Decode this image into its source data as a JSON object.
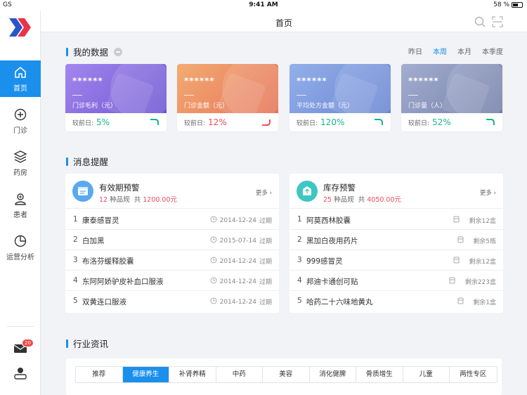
{
  "status_bar": {
    "carrier": "GS",
    "time": "9:41 AM",
    "battery": "58 %"
  },
  "sidebar": {
    "items": [
      {
        "label": "首页",
        "icon": "home-icon",
        "active": true
      },
      {
        "label": "门诊",
        "icon": "clinic-icon",
        "active": false
      },
      {
        "label": "药房",
        "icon": "layers-icon",
        "active": false
      },
      {
        "label": "患者",
        "icon": "patient-icon",
        "active": false
      },
      {
        "label": "运营分析",
        "icon": "pie-chart-icon",
        "active": false
      }
    ],
    "message_badge": "20"
  },
  "header": {
    "title": "首页"
  },
  "my_data": {
    "title": "我的数据",
    "periods": [
      "昨日",
      "本周",
      "本月",
      "本季度"
    ],
    "active_period": "本周",
    "cards": [
      {
        "masked": "******",
        "label": "门诊毛利（元）",
        "compare_label": "较前日:",
        "pct": "5%",
        "trend": "up",
        "gradient": [
          "#9b7de8",
          "#6f5bd4"
        ]
      },
      {
        "masked": "******",
        "label": "门诊金额（元）",
        "compare_label": "较前日:",
        "pct": "12%",
        "trend": "down",
        "gradient": [
          "#f2a36c",
          "#e8785c"
        ]
      },
      {
        "masked": "******",
        "label": "平均处方金额（元）",
        "compare_label": "较前日:",
        "pct": "120%",
        "trend": "up",
        "gradient": [
          "#8aa8e6",
          "#6c88d4"
        ]
      },
      {
        "masked": "******",
        "label": "门诊量（人）",
        "compare_label": "较前日:",
        "pct": "52%",
        "trend": "up",
        "gradient": [
          "#98a4c8",
          "#7a87b0"
        ]
      }
    ]
  },
  "alerts": {
    "title": "消息提醒",
    "panels": [
      {
        "title": "有效期预警",
        "count": "12",
        "count_unit": "种品规",
        "total_prefix": "共",
        "total": "1200.00元",
        "more": "更多",
        "icon_color": "#5aa8ef",
        "rows": [
          {
            "n": "1",
            "name": "康泰感冒灵",
            "date": "2014-12-24",
            "status": "过期"
          },
          {
            "n": "2",
            "name": "白加黑",
            "date": "2015-07-14",
            "status": "过期"
          },
          {
            "n": "3",
            "name": "布洛芬缓释胶囊",
            "date": "2014-12-24",
            "status": "过期"
          },
          {
            "n": "4",
            "name": "东阿阿娇驴皮补血口服液",
            "date": "2014-12-24",
            "status": "过期"
          },
          {
            "n": "5",
            "name": "双黄连口服液",
            "date": "2014-12-24",
            "status": "过期"
          }
        ]
      },
      {
        "title": "库存预警",
        "count": "25",
        "count_unit": "种品规",
        "total_prefix": "共",
        "total": "4050.00元",
        "more": "更多",
        "icon_color": "#3ec7c3",
        "rows": [
          {
            "n": "1",
            "name": "阿莫西林胶囊",
            "remain": "剩余12盒"
          },
          {
            "n": "2",
            "name": "黑加白夜用药片",
            "remain": "剩余5瓶"
          },
          {
            "n": "3",
            "name": "999感冒灵",
            "remain": "剩余12盒"
          },
          {
            "n": "4",
            "name": "邦迪卡通创可贴",
            "remain": "剩余223盒"
          },
          {
            "n": "5",
            "name": "哈药二十六味地黄丸",
            "remain": "剩余1盒"
          }
        ]
      }
    ]
  },
  "news": {
    "title": "行业资讯",
    "tabs": [
      "推荐",
      "健康养生",
      "补肾养精",
      "中药",
      "美容",
      "消化健脾",
      "骨质增生",
      "儿童",
      "两性专区"
    ],
    "active_tab": "健康养生"
  },
  "colors": {
    "accent": "#1a8fec",
    "up": "#19b48c",
    "down": "#ef4b5a"
  }
}
